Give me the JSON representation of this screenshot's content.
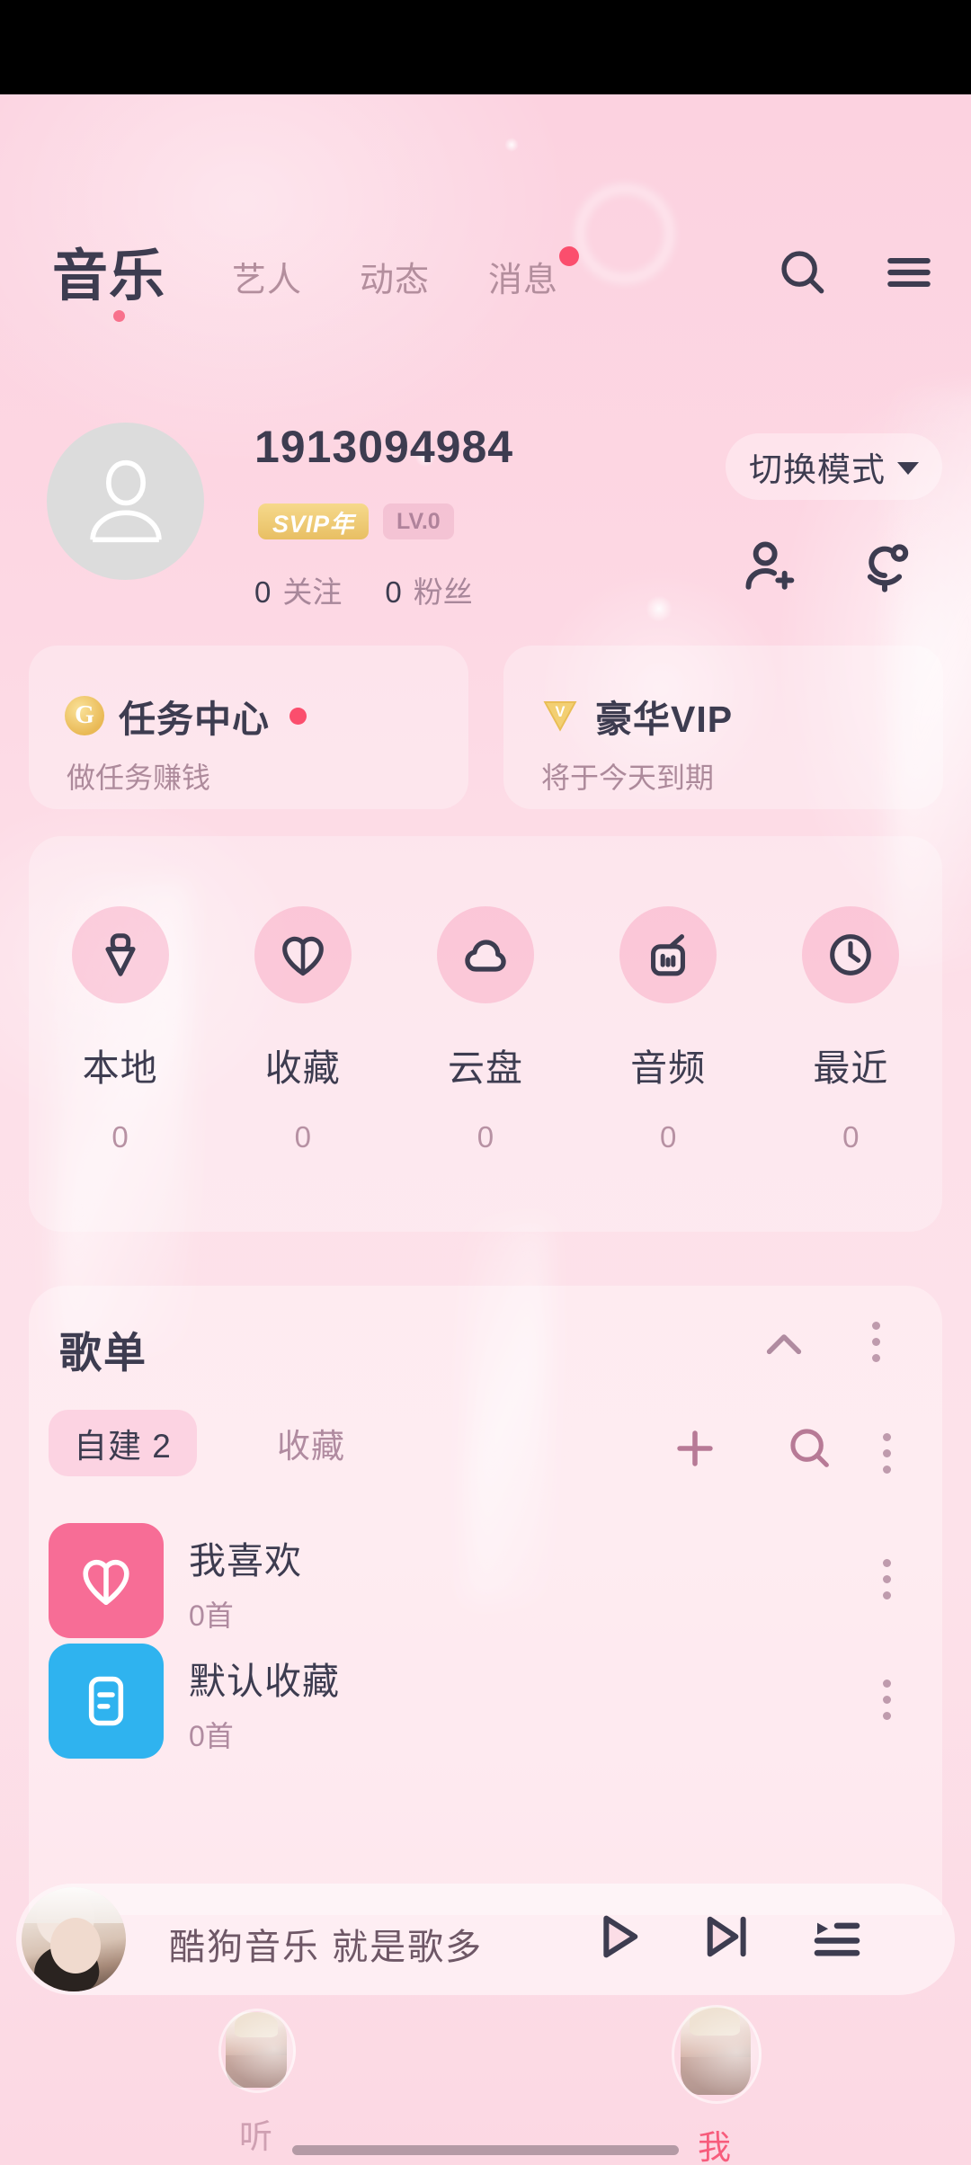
{
  "app": {
    "name": "酷狗音乐"
  },
  "topnav": {
    "active_tab": "音乐",
    "tabs": [
      "艺人",
      "动态",
      "消息"
    ],
    "message_badge": true,
    "icons": {
      "search": "search-icon",
      "menu": "hamburger-menu-icon"
    }
  },
  "profile": {
    "username": "1913094984",
    "badges": {
      "vip": "SVIP年",
      "level": "LV.0"
    },
    "following": {
      "count": "0",
      "label": "关注"
    },
    "followers": {
      "count": "0",
      "label": "粉丝"
    },
    "mode_switch": "切换模式",
    "actions": [
      "add-friend-icon",
      "ktv-mic-icon"
    ]
  },
  "entry_cards": [
    {
      "title": "任务中心",
      "subtitle": "做任务赚钱",
      "icon": "gold-coin-icon",
      "dot": true
    },
    {
      "title": "豪华VIP",
      "subtitle": "将于今天到期",
      "icon": "vip-diamond-icon",
      "dot": false
    }
  ],
  "quick_access": [
    {
      "label": "本地",
      "count": "0",
      "icon": "local-music-icon"
    },
    {
      "label": "收藏",
      "count": "0",
      "icon": "heart-icon"
    },
    {
      "label": "云盘",
      "count": "0",
      "icon": "cloud-icon"
    },
    {
      "label": "音频",
      "count": "0",
      "icon": "radio-icon"
    },
    {
      "label": "最近",
      "count": "0",
      "icon": "clock-icon"
    }
  ],
  "playlist_panel": {
    "title": "歌单",
    "collapse_icon": "chevron-up-icon",
    "more_icon": "more-vertical-icon",
    "tabs": [
      {
        "label": "自建 2",
        "active": true
      },
      {
        "label": "收藏",
        "active": false
      }
    ],
    "actions": [
      "plus-icon",
      "search-icon",
      "more-vertical-icon"
    ],
    "items": [
      {
        "name": "我喜欢",
        "count": "0首",
        "thumb": "heart-icon",
        "color": "#f76d96"
      },
      {
        "name": "默认收藏",
        "count": "0首",
        "thumb": "list-icon",
        "color": "#2fb3ef"
      }
    ]
  },
  "mini_player": {
    "title": "酷狗音乐  就是歌多",
    "album_art": "album-art-photo",
    "controls": [
      "play-icon",
      "next-track-icon",
      "playlist-queue-icon"
    ]
  },
  "bottom_nav": [
    {
      "label": "听",
      "active": false,
      "icon": "listen-avatar-icon"
    },
    {
      "label": "我",
      "active": true,
      "icon": "profile-avatar-icon"
    }
  ],
  "colors": {
    "background": "#fcd2e0",
    "text_dark": "#3d3c50",
    "text_muted": "#b08ba0",
    "accent_pink": "#f75c7c",
    "badge_red": "#fb4e6d",
    "vip_gold": "#e8bf63"
  }
}
